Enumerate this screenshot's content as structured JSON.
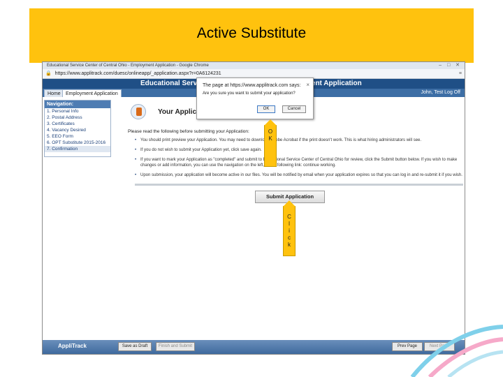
{
  "slide": {
    "title": "Active Substitute"
  },
  "browser": {
    "window_title": "Educational Service Center of Central Ohio - Employment Application - Google Chrome",
    "address": "https://www.applitrack.com/duesc/onlineapp/_application.aspx?r=0A6124231",
    "window_controls": "– □ ✕",
    "menu_glyph": "≡"
  },
  "app": {
    "header_left": "Educational Serv",
    "header_right": "ment Application",
    "tabs": [
      "Home",
      "Employment Application"
    ],
    "user": "John, Test  Log Off",
    "nav_heading": "Navigation:",
    "nav_items": [
      "1. Personal Info",
      "2. Postal Address",
      "3. Certificates",
      "4. Vacancy Desired",
      "5. EEO Form",
      "6. OPT Substitute 2015-2016",
      "7. Confirmation"
    ],
    "page_heading": "Your Applicat",
    "read_line": "Please read the following before submitting your Application:",
    "bullets": [
      "You should print preview your Application. You may need to download Adobe Acrobat if the print doesn't work. This is what hiring administrators will see.",
      "If you do not wish to submit your Application yet, click save again.",
      "If you want to mark your Application as \"completed\" and submit to Educational Service Center of Central Ohio for review, click the Submit button below. If you wish to make changes or add information, you can use the navigation on the left, or the following link: continue working.",
      "Upon submission, your application will become active in our files. You will be notified by email when your application expires so that you can log in and re-submit it if you wish."
    ],
    "submit_label": "Submit Application"
  },
  "dialog": {
    "title": "The page at https://www.applitrack.com says:",
    "message": "Are you sure you want to submit your application?",
    "ok_label": "OK",
    "cancel_label": "Cancel",
    "close_glyph": "×"
  },
  "callouts": {
    "ok": [
      "O",
      "K"
    ],
    "click": [
      "C",
      "l",
      "i",
      "c",
      "k"
    ]
  },
  "footer": {
    "brand": "AppliTrack",
    "save_label": "Save as Draft",
    "finish_label": "Finish and Submit",
    "prev_label": "Prev Page",
    "next_label": "Next Page"
  },
  "colors": {
    "accent": "#ffc20e",
    "header": "#1f4f86",
    "footer": "#3f6a9e"
  }
}
